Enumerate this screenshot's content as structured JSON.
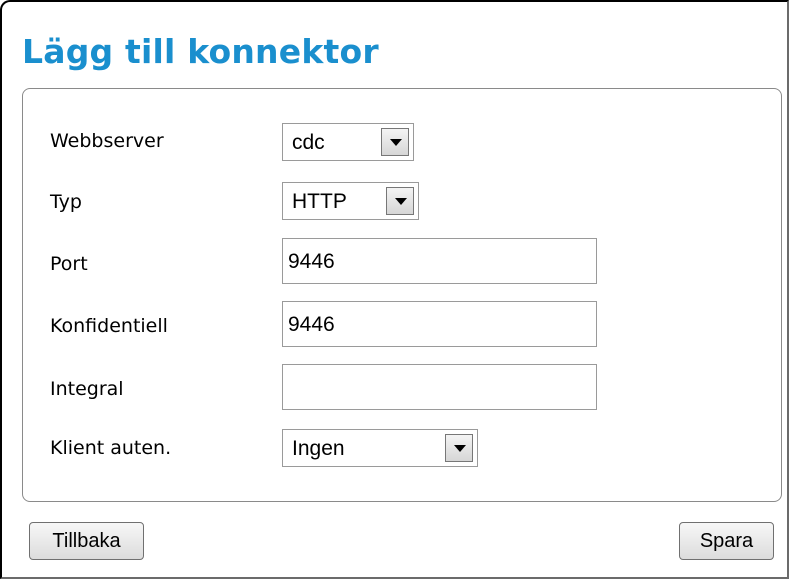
{
  "dialog": {
    "title": "Lägg till konnektor",
    "fields": {
      "webserver": {
        "label": "Webbserver",
        "value": "cdc"
      },
      "type": {
        "label": "Typ",
        "value": "HTTP"
      },
      "port": {
        "label": "Port",
        "value": "9446"
      },
      "confidential": {
        "label": "Konfidentiell",
        "value": "9446"
      },
      "integral": {
        "label": "Integral",
        "value": ""
      },
      "client_auth": {
        "label": "Klient auten.",
        "value": "Ingen"
      }
    },
    "buttons": {
      "back": "Tillbaka",
      "save": "Spara"
    }
  }
}
